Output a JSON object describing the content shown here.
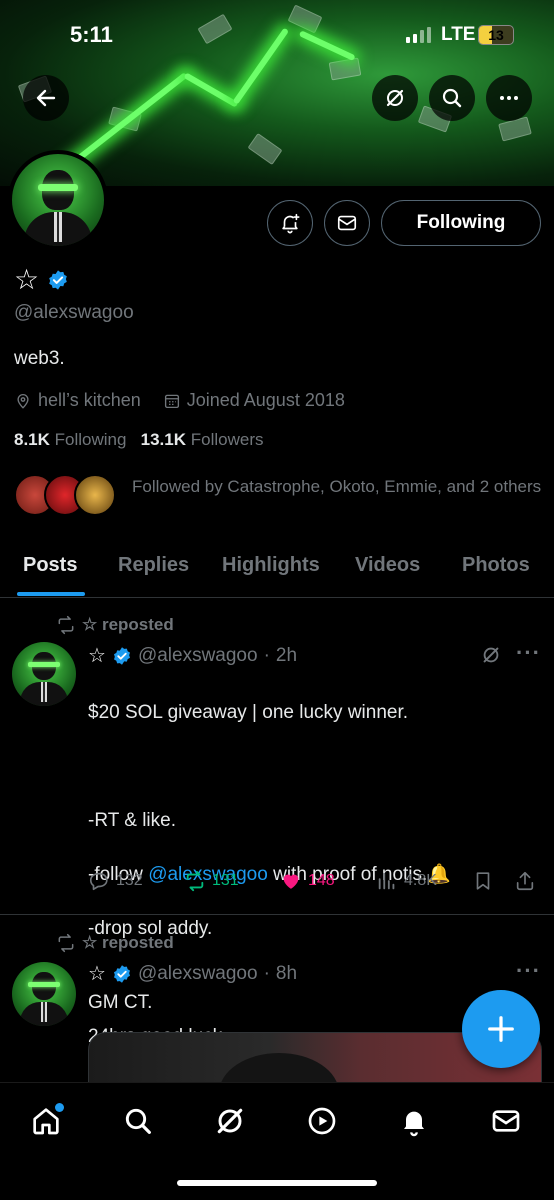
{
  "status_bar": {
    "time": "5:11",
    "network": "LTE",
    "battery": "13"
  },
  "profile": {
    "display_name": "☆",
    "handle": "@alexswagoo",
    "bio": "web3.",
    "location": "hell’s kitchen",
    "joined": "Joined August 2018",
    "following_count": "8.1K",
    "following_label": "Following",
    "followers_count": "13.1K",
    "followers_label": "Followers",
    "followed_by": "Followed by Catastrophe, Okoto, Emmie, and 2 others",
    "follow_button_label": "Following"
  },
  "tabs": [
    "Posts",
    "Replies",
    "Highlights",
    "Videos",
    "Photos"
  ],
  "posts": [
    {
      "repost_label": "☆ reposted",
      "author_name": "☆",
      "author_handle": "@alexswagoo",
      "time": "2h",
      "body_line1": "$20 SOL giveaway | one lucky winner.",
      "body_line2": "-RT & like.",
      "body_line3_pre": "-follow ",
      "body_line3_link": "@alexswagoo",
      "body_line3_post": " with proof of notis.🔔",
      "body_line4": "-drop sol addy.",
      "body_line5": "24hrs good luck.",
      "replies": "132",
      "reposts": "131",
      "likes": "148",
      "views": "4.8K"
    },
    {
      "repost_label": "☆ reposted",
      "author_name": "☆",
      "author_handle": "@alexswagoo",
      "time": "8h",
      "body": "GM CT."
    }
  ],
  "colors": {
    "accent": "#1d9bf0",
    "repost": "#00ba7c",
    "like": "#f91880",
    "muted": "#71767b"
  },
  "icons": {
    "back": "arrow-left-icon",
    "grok": "grok-icon",
    "search": "search-icon",
    "more": "more-icon",
    "notify": "bell-plus-icon",
    "message": "envelope-icon",
    "location": "location-icon",
    "calendar": "calendar-icon"
  }
}
